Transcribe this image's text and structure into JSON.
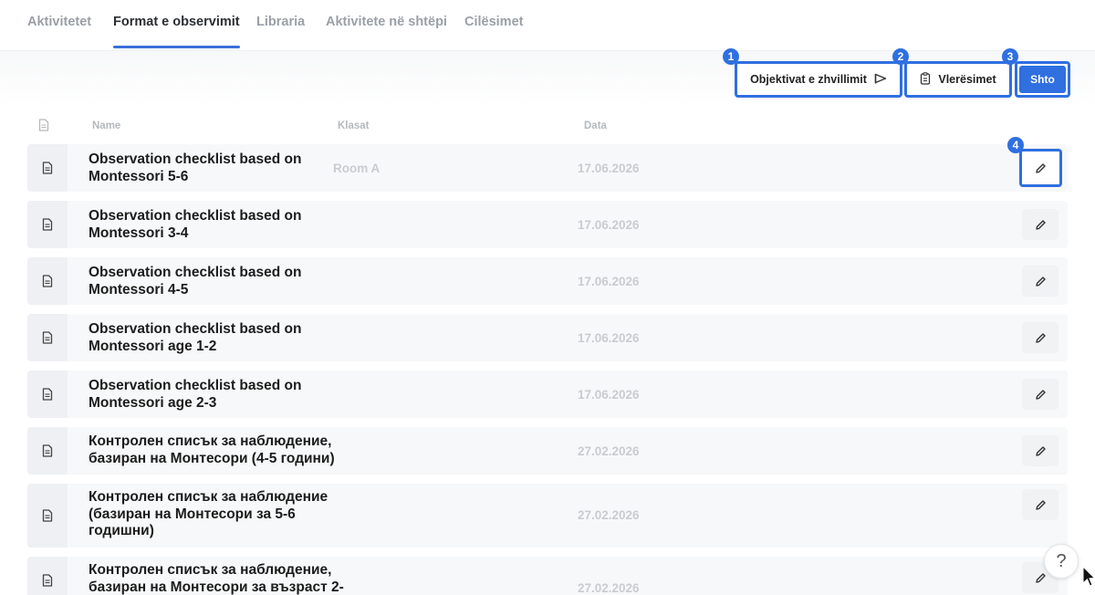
{
  "tabs": [
    {
      "label": "Aktivitetet"
    },
    {
      "label": "Format e observimit"
    },
    {
      "label": "Libraria"
    },
    {
      "label": "Aktivitete në shtëpi"
    },
    {
      "label": "Cilësimet"
    }
  ],
  "toolbar": {
    "objectives_label": "Objektivat e zhvillimit",
    "assessments_label": "Vlerësimet",
    "add_label": "Shto",
    "badges": [
      "1",
      "2",
      "3",
      "4"
    ]
  },
  "table": {
    "columns": [
      "Name",
      "Klasat",
      "Data"
    ],
    "rows": [
      {
        "name": "Observation checklist based on Montessori 5-6",
        "klasat": "Room A",
        "data": "17.06.2026"
      },
      {
        "name": "Observation checklist based on Montessori 3-4",
        "klasat": "",
        "data": "17.06.2026"
      },
      {
        "name": "Observation checklist based on Montessori 4-5",
        "klasat": "",
        "data": "17.06.2026"
      },
      {
        "name": "Observation checklist based on Montessori age 1-2",
        "klasat": "",
        "data": "17.06.2026"
      },
      {
        "name": "Observation checklist based on Montessori age 2-3",
        "klasat": "",
        "data": "17.06.2026"
      },
      {
        "name": "Контролен списък за наблюдение, базиран на Монтесори (4-5 години)",
        "klasat": "",
        "data": "27.02.2026"
      },
      {
        "name": "Контролен списък за наблюдение (базиран на Монтесори за 5-6 годишни)",
        "klasat": "",
        "data": "27.02.2026"
      },
      {
        "name": "Контролен списък за наблюдение, базиран на Монтесори за възраст 2-",
        "klasat": "",
        "data": "27.02.2026"
      }
    ]
  },
  "help": {
    "label": "?"
  },
  "colors": {
    "accent": "#2f6fe0",
    "row_bg": "#f7f8f9",
    "muted": "#c9ccd0"
  }
}
